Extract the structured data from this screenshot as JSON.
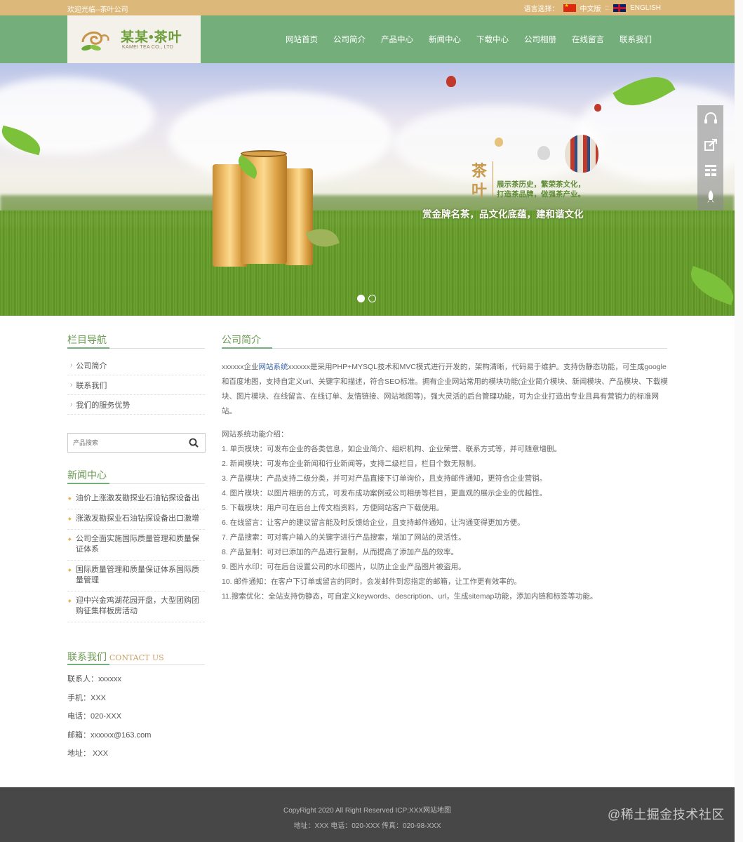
{
  "topbar": {
    "welcome": "欢迎光临--茶叶公司",
    "lang_label": "语言选择：",
    "lang_cn": "中文版",
    "lang_sep": "::",
    "lang_en": "ENGLISH"
  },
  "header": {
    "logo_cn": "某某•茶叶",
    "logo_en": "KAMEI TEA CO., LTD",
    "nav": [
      "网站首页",
      "公司简介",
      "产品中心",
      "新闻中心",
      "下载中心",
      "公司相册",
      "在线留言",
      "联系我们"
    ]
  },
  "banner": {
    "tea_title_1": "茶",
    "tea_title_2": "叶",
    "tea_line_1": "展示茶历史，繁荣茶文化，",
    "tea_line_2": "打造茶品牌，做强茶产业。",
    "slogan": "赏金牌名茶，品文化底蕴，建和谐文化",
    "slides": 2,
    "active_slide": 1
  },
  "sidebar": {
    "nav_title": "栏目导航",
    "nav_items": [
      "公司简介",
      "联系我们",
      "我们的服务优势"
    ],
    "search_placeholder": "产品搜索",
    "news_title": "新闻中心",
    "news_items": [
      "油价上涨激发勘探业石油钻探设备出",
      "涨激发勘探业石油钻探设备出口激增",
      "公司全面实施国际质量管理和质量保证体系",
      "国际质量管理和质量保证体系国际质量管理",
      "迎中兴金鸡湖花园开盘，大型团购团购征集样板房活动"
    ],
    "contact_title": "联系我们",
    "contact_title_en": "CONTACT US",
    "contact": [
      "联系人：xxxxxx",
      "手机：XXX",
      "电话：020-XXX",
      "邮箱：xxxxxx@163.com",
      "地址：  XXX"
    ]
  },
  "main": {
    "title": "公司简介",
    "intro_pre": "xxxxxx企业",
    "intro_link": "网站系统",
    "intro_post": "xxxxxx是采用PHP+MYSQL技术和MVC模式进行开发的，架构清晰，代码易于维护。支持伪静态功能，可生成google和百度地图，支持自定义url、关键字和描述，符合SEO标准。拥有企业网站常用的模块功能(企业简介模块、新闻模块、产品模块、下载模块、图片模块、在线留言、在线订单、友情链接、网站地图等)，强大灵活的后台管理功能，可为企业打造出专业且具有营销力的标准网站。",
    "features_title": "网站系统功能介绍：",
    "features": [
      "1. 单页模块：可发布企业的各类信息，如企业简介、组织机构、企业荣誉、联系方式等，并可随意增删。",
      "2. 新闻模块：可发布企业新闻和行业新闻等，支持二级栏目，栏目个数无限制。",
      "3. 产品模块：产品支持二级分类，并可对产品直接下订单询价，且支持邮件通知，更符合企业营销。",
      "4. 图片模块：以图片相册的方式，可发布成功案例或公司相册等栏目，更直观的展示企业的优越性。",
      "5. 下载模块：用户可在后台上传文档资料，方便网站客户下载使用。",
      "6. 在线留言：让客户的建议留言能及时反馈给企业，且支持邮件通知，让沟通变得更加方便。",
      "7. 产品搜索：可对客户输入的关键字进行产品搜索，增加了网站的灵活性。",
      "8. 产品复制：可对已添加的产品进行复制，从而提高了添加产品的效率。",
      "9. 图片水印：可在后台设置公司的水印图片，以防止企业产品图片被盗用。",
      "10. 邮件通知：在客户下订单或留言的同时，会发邮件到您指定的邮箱，让工作更有效率的。",
      "11.搜索优化：全站支持伪静态，可自定义keywords、description、url，生成sitemap功能，添加内链和标签等功能。"
    ]
  },
  "footer": {
    "line1": "CopyRight 2020 All Right Reserved  ICP:XXX网站地图",
    "line2": "地址：XXX  电话：020-XXX  传真：020-98-XXX"
  },
  "watermark": "@稀土掘金技术社区",
  "colors": {
    "topbar": "#dcb87a",
    "header": "#74ae7a",
    "accent": "#6b9a52",
    "footer": "#474747"
  },
  "icons": [
    "search-icon",
    "headset-icon",
    "share-icon",
    "qrcode-icon",
    "rocket-icon",
    "arrow-right-icon",
    "diamond-bullet-icon"
  ]
}
